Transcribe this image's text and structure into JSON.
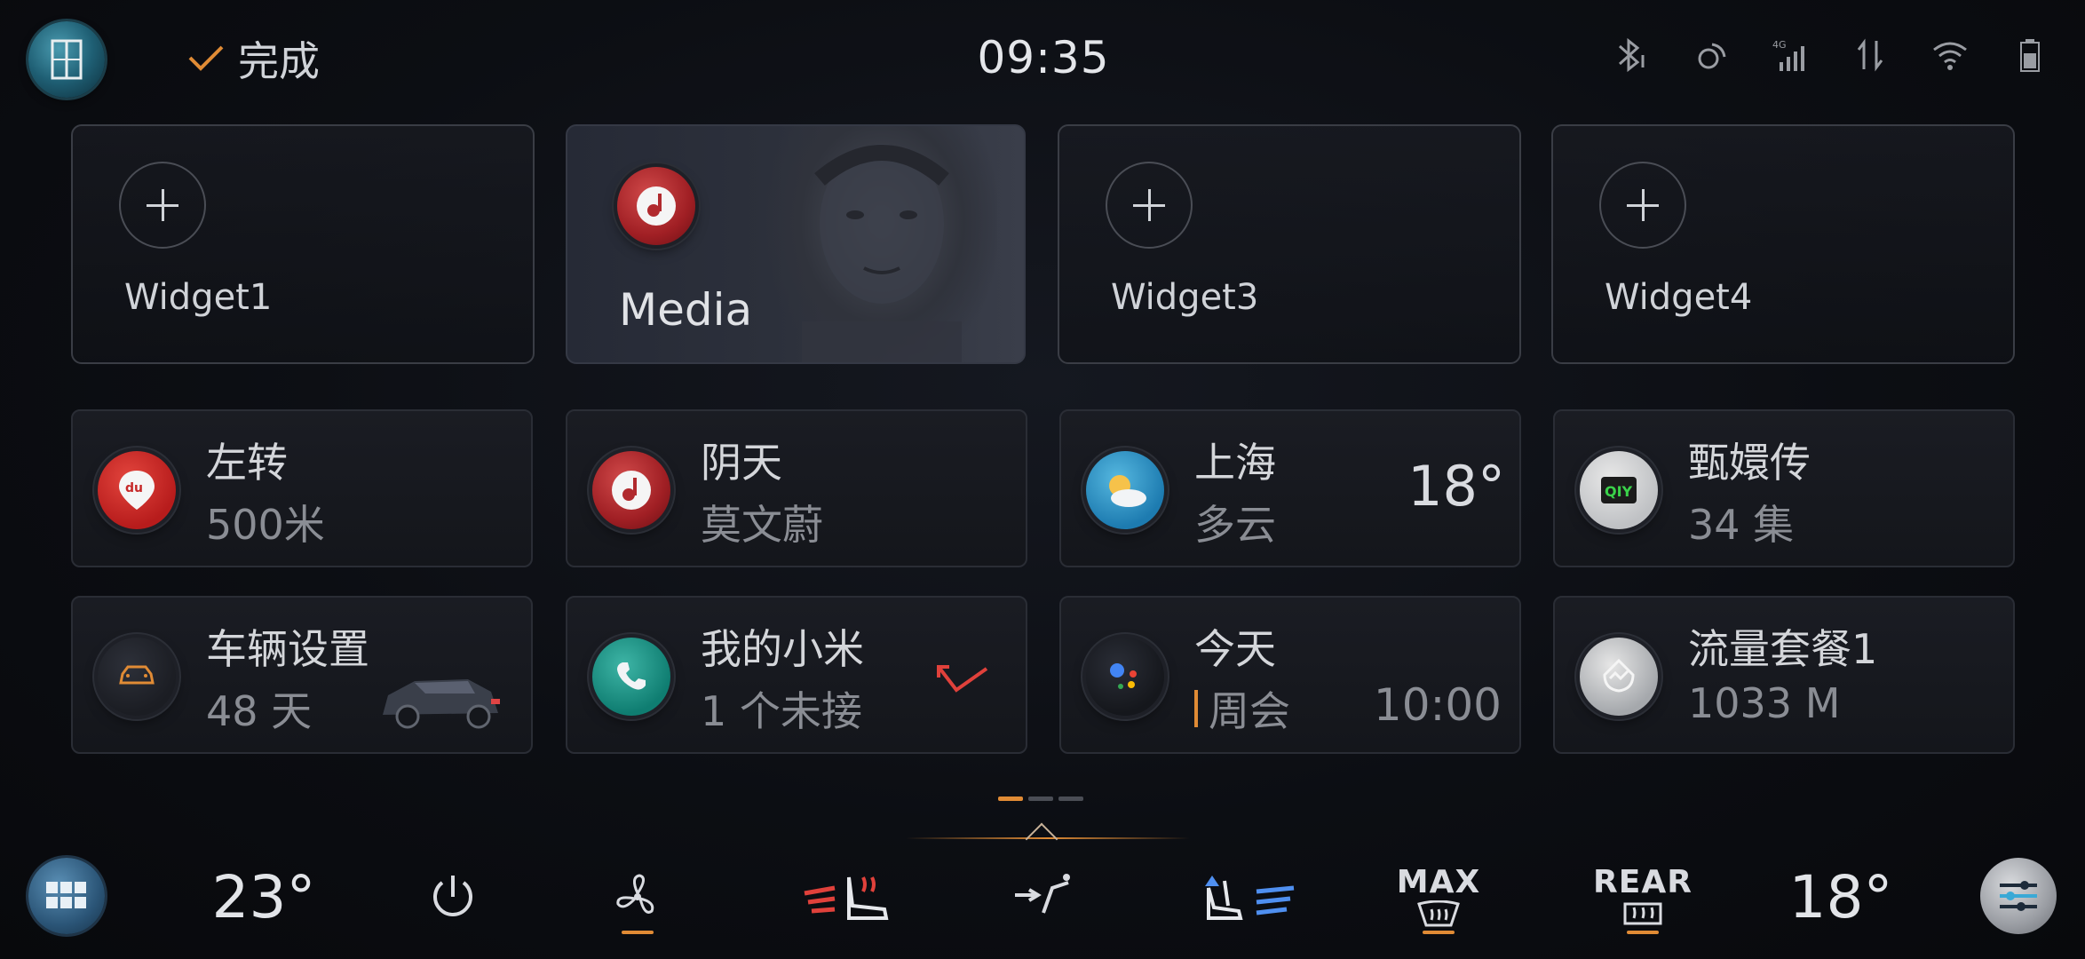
{
  "topbar": {
    "done_label": "完成",
    "clock": "09:35"
  },
  "widgets": {
    "w1": "Widget1",
    "media": "Media",
    "w3": "Widget3",
    "w4": "Widget4"
  },
  "cards": {
    "nav": {
      "title": "左转",
      "sub": "500米"
    },
    "music": {
      "title": "阴天",
      "sub": "莫文蔚"
    },
    "weather": {
      "title": "上海",
      "sub": "多云",
      "temp": "18°"
    },
    "video": {
      "title": "甄嬛传",
      "sub": "34 集"
    },
    "vehicle": {
      "title": "车辆设置",
      "sub": "48 天"
    },
    "phone": {
      "title": "我的小米",
      "sub": "1 个未接"
    },
    "schedule": {
      "title": "今天",
      "sub": "周会",
      "time": "10:00"
    },
    "data_plan": {
      "title": "流量套餐1",
      "sub": "1033 M"
    }
  },
  "climate": {
    "driver_temp": "23°",
    "passenger_temp": "18°",
    "max_label": "MAX",
    "rear_label": "REAR"
  },
  "accent_color": "#e08b35"
}
